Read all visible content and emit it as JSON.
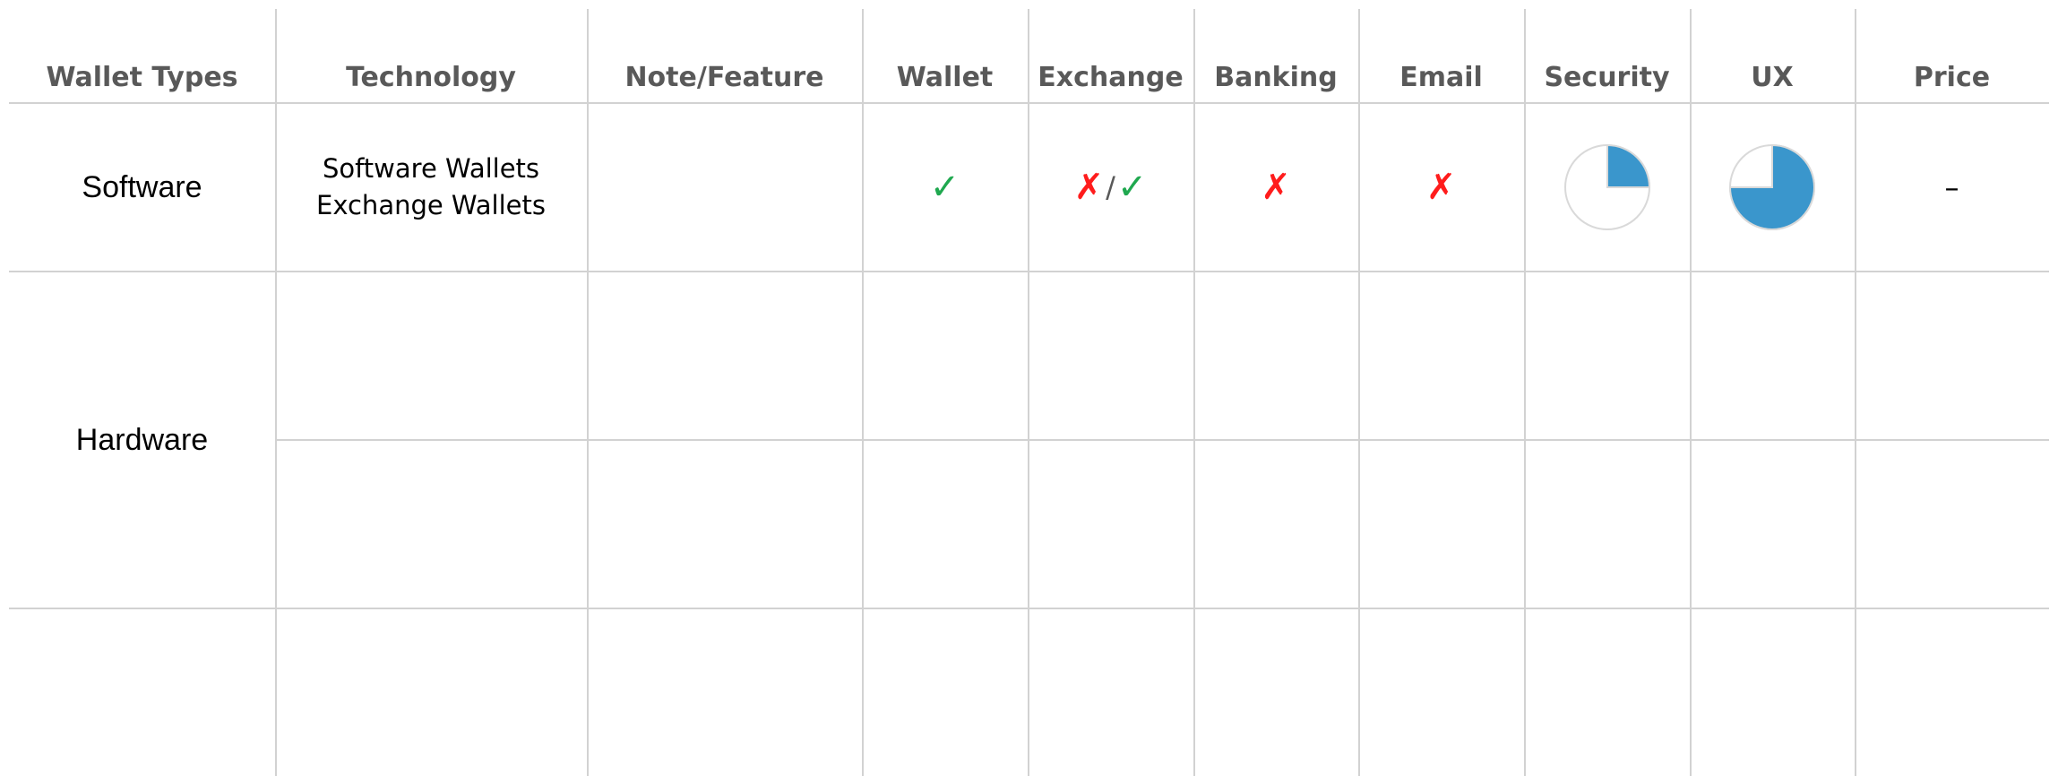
{
  "headers": [
    "Wallet Types",
    "Technology",
    "Note/Feature",
    "Wallet",
    "Exchange",
    "Banking",
    "Email",
    "Security",
    "UX",
    "Price"
  ],
  "rows": {
    "software": {
      "type": "Software",
      "technology": [
        "Software Wallets",
        "Exchange Wallets"
      ],
      "note": "",
      "wallet": "✓",
      "exchange": {
        "no": "✗",
        "sep": "/",
        "yes": "✓"
      },
      "banking": "✗",
      "email": "✗",
      "security_level": 0.25,
      "ux_level": 0.75,
      "price": "–"
    },
    "hardware": {
      "type": "Hardware"
    }
  },
  "colors": {
    "check": "#1fa84f",
    "cross": "#ff1c1c",
    "pie_fill": "#3a96cc",
    "pie_outline": "#d9d9d9"
  },
  "icons": {
    "yes": "check-icon",
    "no": "cross-icon",
    "level": "pie-gauge-icon"
  }
}
